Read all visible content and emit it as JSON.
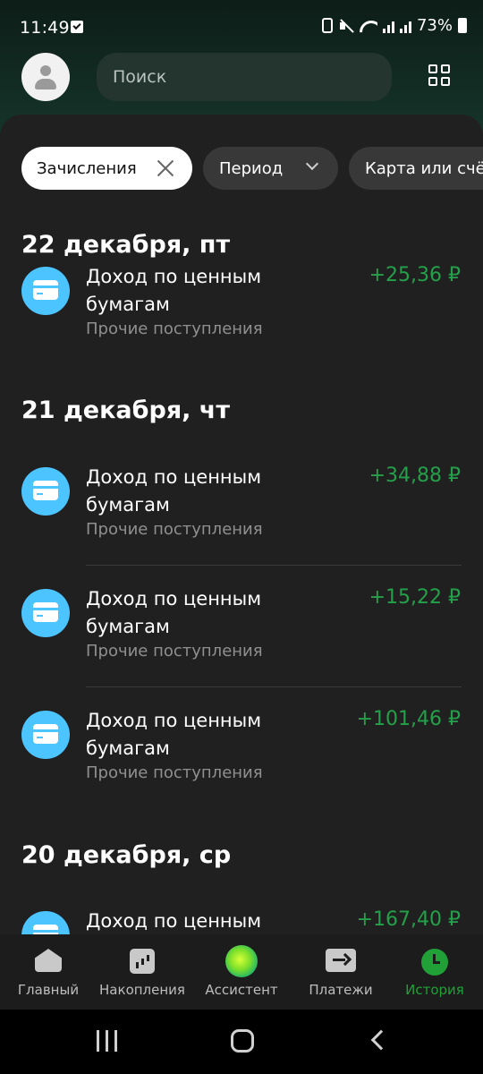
{
  "status_bar": {
    "time": "11:49",
    "battery": "73%"
  },
  "header": {
    "search_placeholder": "Поиск"
  },
  "filters": {
    "active_chip": "Зачисления",
    "period_chip": "Период",
    "card_chip": "Карта или счё"
  },
  "groups": [
    {
      "date": "22 декабря, пт",
      "items": [
        {
          "title": "Доход по ценным бумагам",
          "category": "Прочие поступления",
          "amount": "+25,36 ₽"
        }
      ]
    },
    {
      "date": "21 декабря, чт",
      "items": [
        {
          "title": "Доход по ценным бумагам",
          "category": "Прочие поступления",
          "amount": "+34,88 ₽"
        },
        {
          "title": "Доход по ценным бумагам",
          "category": "Прочие поступления",
          "amount": "+15,22 ₽"
        },
        {
          "title": "Доход по ценным бумагам",
          "category": "Прочие поступления",
          "amount": "+101,46 ₽"
        }
      ]
    },
    {
      "date": "20 декабря, ср",
      "items": [
        {
          "title": "Доход по ценным бумагам",
          "category": "",
          "amount": "+167,40 ₽"
        }
      ]
    }
  ],
  "bottom_nav": [
    {
      "label": "Главный",
      "icon": "home-icon"
    },
    {
      "label": "Накопления",
      "icon": "savings-chart-icon"
    },
    {
      "label": "Ассистент",
      "icon": "assistant-orb-icon"
    },
    {
      "label": "Платежи",
      "icon": "payments-arrow-icon"
    },
    {
      "label": "История",
      "icon": "history-clock-icon",
      "active": true
    }
  ],
  "colors": {
    "accent_green": "#21a038",
    "amount_green": "#25a04a",
    "icon_blue": "#4cc4ff",
    "background": "#202020"
  }
}
